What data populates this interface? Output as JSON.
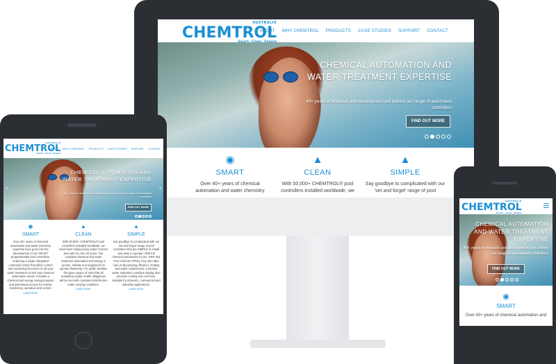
{
  "brand": {
    "logo_text": "CHEMTROL",
    "logo_country": "AUSTRALIA",
    "logo_tagline": "Smart. Clean. Simple"
  },
  "nav": [
    "ABOUT",
    "WHY CHEMTROL",
    "PRODUCTS",
    "CASE STUDIES",
    "SUPPORT",
    "CONTACT"
  ],
  "hero": {
    "headline": "CHEMICAL AUTOMATION AND WATER TREATMENT EXPERTISE",
    "subtext": "40+ years of research and development are behind our range of automated controllers",
    "button": "FIND OUT MORE",
    "slide_count": 5,
    "active_slide": 2
  },
  "desktop_features": [
    {
      "icon": "lightbulb-icon",
      "title": "SMART",
      "desc": "Over 40+ years of chemical automation and water chemistry"
    },
    {
      "icon": "flask-icon",
      "title": "CLEAN",
      "desc": "With 50,000+ CHEMTROL® pool controllers installed worldwide, we"
    },
    {
      "icon": "thumbs-up-icon",
      "title": "SIMPLE",
      "desc": "Say goodbye to complicated with our 'set and forget' range of pool"
    }
  ],
  "tablet_features": [
    {
      "icon": "lightbulb-icon",
      "title": "SMART",
      "desc": "Over 40+ years of chemical automation and water chemistry expertise have gone into the development of our SMART programmable pool controllers. Featuring a single integrated command centre that offers control and monitoring functions for all your water treatment control and chemical automation needs. Includes a chemical and energy saving program and web-based access for remote monitoring, operation and control.",
      "more": "Learn more"
    },
    {
      "icon": "flask-icon",
      "title": "CLEAN",
      "desc": "With 50,000+ CHEMTROL® pool controllers installed worldwide, we have been helping keep water CLEAN and safe for over 40 years. Our complete chemical and water treatment automation technology is proven, reliable and engineered to operate flawlessly. For public facilities this gives peace of mind that all mandatory public health obligations will be met with consistent disinfection under varying conditions.",
      "more": "Learn more"
    },
    {
      "icon": "thumbs-up-icon",
      "title": "SIMPLE",
      "desc": "Say goodbye to complicated with our 'set and forget' range of pool controllers that are SIMPLE to install and easy to operate. With full chemical automation for pH, ORP and Free Chlorine (PPM), they also take care of all pumping, filtration, heating and water replacement. Constant water saturation condition display also prevents scaling and corrosion. Suitable for domestic, commercial and industrial applications.",
      "more": "Learn more"
    }
  ],
  "phone_feature": {
    "icon": "lightbulb-icon",
    "title": "SMART",
    "desc": "Over 40+ years of chemical automation and"
  },
  "colors": {
    "brand_blue": "#1c8fd3",
    "device_dark": "#2b2e33",
    "stand_grey": "#e4e6e9"
  }
}
